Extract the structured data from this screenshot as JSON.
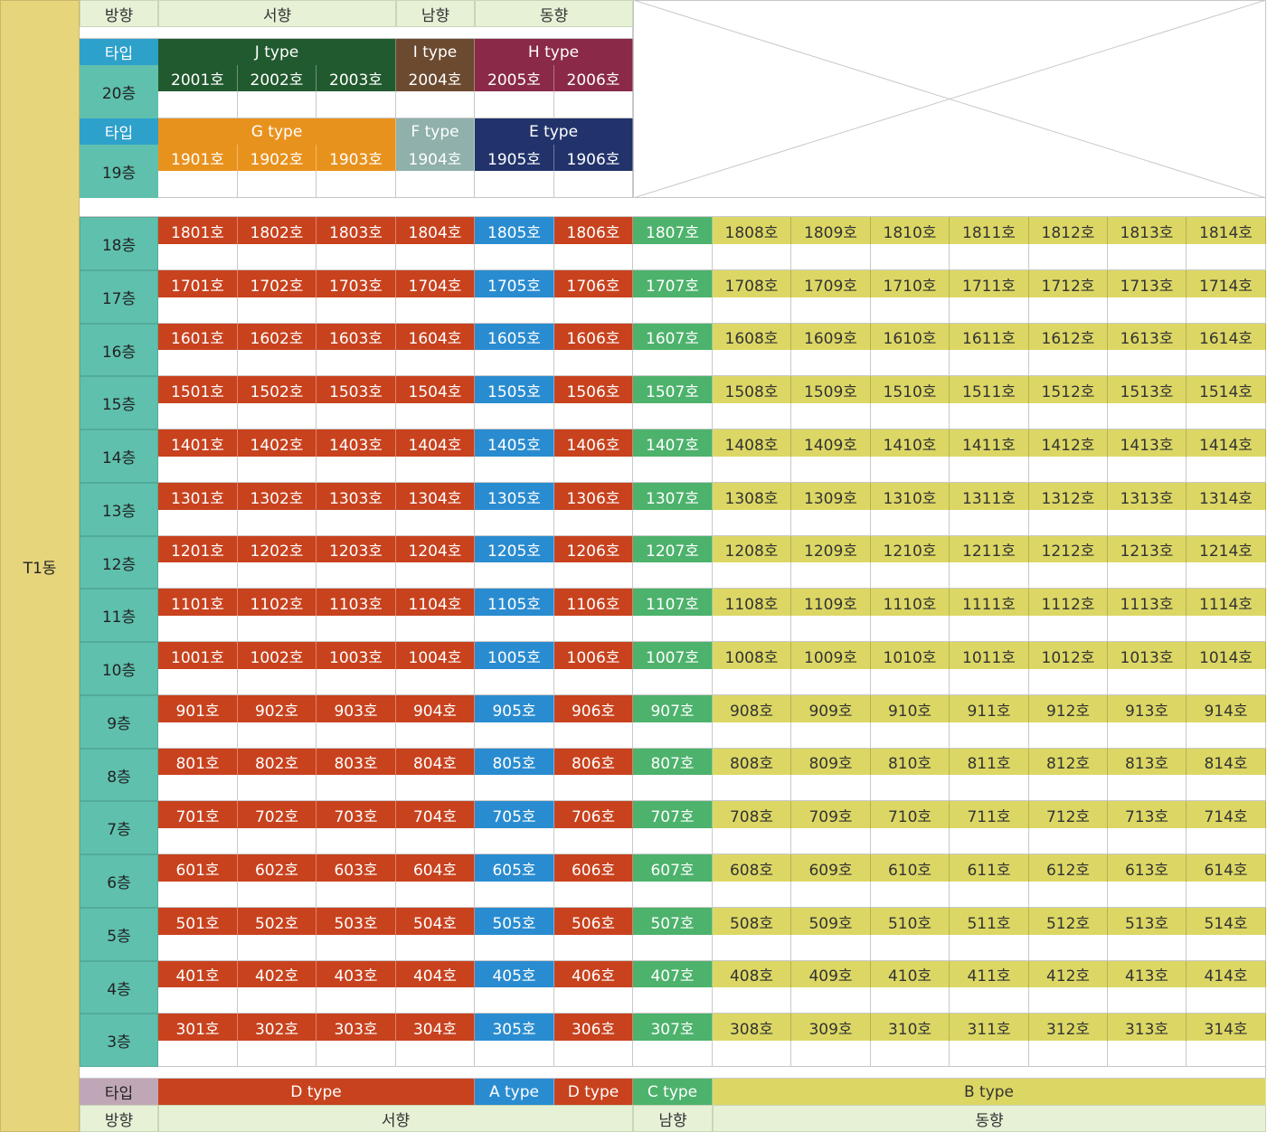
{
  "building": "T1동",
  "colors": {
    "building_col": "#e7d57c",
    "direction_bg": "#e6f1d6",
    "type_label_bg": "#2ea1cb",
    "floor_bg": "#5fc0ad",
    "bottom_type_label_bg": "#c0a7b7",
    "J": "#225a2f",
    "I": "#6b4a30",
    "H": "#8a2a48",
    "G": "#e8921e",
    "F": "#8fb0ab",
    "E": "#22336b",
    "D": "#c8421e",
    "A": "#2a8cd0",
    "C": "#4db26c",
    "B": "#dcd764"
  },
  "top_header": {
    "direction_label": "방향",
    "west": "서향",
    "south": "남향",
    "east": "동향"
  },
  "upper_floors": [
    {
      "type_label": "타입",
      "floor": "20층",
      "types": [
        {
          "name": "J type",
          "color_key": "J"
        },
        {
          "name": "I type",
          "color_key": "I"
        },
        {
          "name": "H type",
          "color_key": "H"
        }
      ],
      "units": [
        {
          "label": "2001호",
          "color_key": "J"
        },
        {
          "label": "2002호",
          "color_key": "J"
        },
        {
          "label": "2003호",
          "color_key": "J"
        },
        {
          "label": "2004호",
          "color_key": "I"
        },
        {
          "label": "2005호",
          "color_key": "H"
        },
        {
          "label": "2006호",
          "color_key": "H"
        }
      ]
    },
    {
      "type_label": "타입",
      "floor": "19층",
      "types": [
        {
          "name": "G type",
          "color_key": "G"
        },
        {
          "name": "F type",
          "color_key": "F"
        },
        {
          "name": "E type",
          "color_key": "E"
        }
      ],
      "units": [
        {
          "label": "1901호",
          "color_key": "G"
        },
        {
          "label": "1902호",
          "color_key": "G"
        },
        {
          "label": "1903호",
          "color_key": "G"
        },
        {
          "label": "1904호",
          "color_key": "F"
        },
        {
          "label": "1905호",
          "color_key": "E"
        },
        {
          "label": "1906호",
          "color_key": "E"
        }
      ]
    }
  ],
  "floors": [
    {
      "floor": "18층",
      "units": [
        "1801호",
        "1802호",
        "1803호",
        "1804호",
        "1805호",
        "1806호",
        "1807호",
        "1808호",
        "1809호",
        "1810호",
        "1811호",
        "1812호",
        "1813호",
        "1814호"
      ]
    },
    {
      "floor": "17층",
      "units": [
        "1701호",
        "1702호",
        "1703호",
        "1704호",
        "1705호",
        "1706호",
        "1707호",
        "1708호",
        "1709호",
        "1710호",
        "1711호",
        "1712호",
        "1713호",
        "1714호"
      ]
    },
    {
      "floor": "16층",
      "units": [
        "1601호",
        "1602호",
        "1603호",
        "1604호",
        "1605호",
        "1606호",
        "1607호",
        "1608호",
        "1609호",
        "1610호",
        "1611호",
        "1612호",
        "1613호",
        "1614호"
      ]
    },
    {
      "floor": "15층",
      "units": [
        "1501호",
        "1502호",
        "1503호",
        "1504호",
        "1505호",
        "1506호",
        "1507호",
        "1508호",
        "1509호",
        "1510호",
        "1511호",
        "1512호",
        "1513호",
        "1514호"
      ]
    },
    {
      "floor": "14층",
      "units": [
        "1401호",
        "1402호",
        "1403호",
        "1404호",
        "1405호",
        "1406호",
        "1407호",
        "1408호",
        "1409호",
        "1410호",
        "1411호",
        "1412호",
        "1413호",
        "1414호"
      ]
    },
    {
      "floor": "13층",
      "units": [
        "1301호",
        "1302호",
        "1303호",
        "1304호",
        "1305호",
        "1306호",
        "1307호",
        "1308호",
        "1309호",
        "1310호",
        "1311호",
        "1312호",
        "1313호",
        "1314호"
      ]
    },
    {
      "floor": "12층",
      "units": [
        "1201호",
        "1202호",
        "1203호",
        "1204호",
        "1205호",
        "1206호",
        "1207호",
        "1208호",
        "1209호",
        "1210호",
        "1211호",
        "1212호",
        "1213호",
        "1214호"
      ]
    },
    {
      "floor": "11층",
      "units": [
        "1101호",
        "1102호",
        "1103호",
        "1104호",
        "1105호",
        "1106호",
        "1107호",
        "1108호",
        "1109호",
        "1110호",
        "1111호",
        "1112호",
        "1113호",
        "1114호"
      ]
    },
    {
      "floor": "10층",
      "units": [
        "1001호",
        "1002호",
        "1003호",
        "1004호",
        "1005호",
        "1006호",
        "1007호",
        "1008호",
        "1009호",
        "1010호",
        "1011호",
        "1012호",
        "1013호",
        "1014호"
      ]
    },
    {
      "floor": "9층",
      "units": [
        "901호",
        "902호",
        "903호",
        "904호",
        "905호",
        "906호",
        "907호",
        "908호",
        "909호",
        "910호",
        "911호",
        "912호",
        "913호",
        "914호"
      ]
    },
    {
      "floor": "8층",
      "units": [
        "801호",
        "802호",
        "803호",
        "804호",
        "805호",
        "806호",
        "807호",
        "808호",
        "809호",
        "810호",
        "811호",
        "812호",
        "813호",
        "814호"
      ]
    },
    {
      "floor": "7층",
      "units": [
        "701호",
        "702호",
        "703호",
        "704호",
        "705호",
        "706호",
        "707호",
        "708호",
        "709호",
        "710호",
        "711호",
        "712호",
        "713호",
        "714호"
      ]
    },
    {
      "floor": "6층",
      "units": [
        "601호",
        "602호",
        "603호",
        "604호",
        "605호",
        "606호",
        "607호",
        "608호",
        "609호",
        "610호",
        "611호",
        "612호",
        "613호",
        "614호"
      ]
    },
    {
      "floor": "5층",
      "units": [
        "501호",
        "502호",
        "503호",
        "504호",
        "505호",
        "506호",
        "507호",
        "508호",
        "509호",
        "510호",
        "511호",
        "512호",
        "513호",
        "514호"
      ]
    },
    {
      "floor": "4층",
      "units": [
        "401호",
        "402호",
        "403호",
        "404호",
        "405호",
        "406호",
        "407호",
        "408호",
        "409호",
        "410호",
        "411호",
        "412호",
        "413호",
        "414호"
      ]
    },
    {
      "floor": "3층",
      "units": [
        "301호",
        "302호",
        "303호",
        "304호",
        "305호",
        "306호",
        "307호",
        "308호",
        "309호",
        "310호",
        "311호",
        "312호",
        "313호",
        "314호"
      ]
    }
  ],
  "lower_column_types": [
    "D",
    "D",
    "D",
    "D",
    "A",
    "D",
    "C",
    "B",
    "B",
    "B",
    "B",
    "B",
    "B",
    "B"
  ],
  "bottom_legend": {
    "type_label": "타입",
    "types": [
      {
        "name": "D type",
        "color_key": "D"
      },
      {
        "name": "A type",
        "color_key": "A"
      },
      {
        "name": "D type",
        "color_key": "D"
      },
      {
        "name": "C type",
        "color_key": "C"
      },
      {
        "name": "B type",
        "color_key": "B"
      }
    ],
    "direction_label": "방향",
    "directions": [
      "서향",
      "남향",
      "동향"
    ]
  }
}
